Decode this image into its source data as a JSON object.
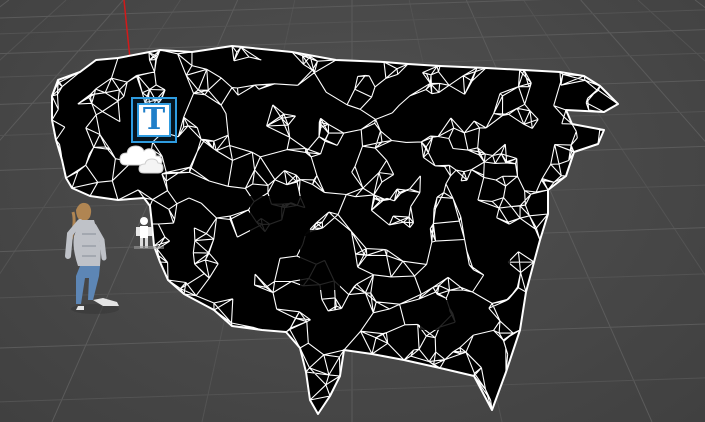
{
  "viewport": {
    "background_color": "#4a4a4a",
    "grid_color": "#5b5b5b",
    "y_axis_color": "#d21a1a"
  },
  "scene": {
    "mesh": {
      "fill_color": "#000000",
      "edge_color": "#ffffff",
      "style": "wireframe"
    },
    "gizmos": [
      {
        "icon": "terrain-gizmo-icon",
        "glyph": "T",
        "color": "#2f9ce0"
      },
      {
        "icon": "wind-zone-cloud-icon"
      },
      {
        "icon": "person-figure-icon"
      }
    ],
    "character": {
      "icon": "character-model",
      "shirt_color": "#b9bcc2",
      "pants_color": "#5d86b5"
    }
  }
}
